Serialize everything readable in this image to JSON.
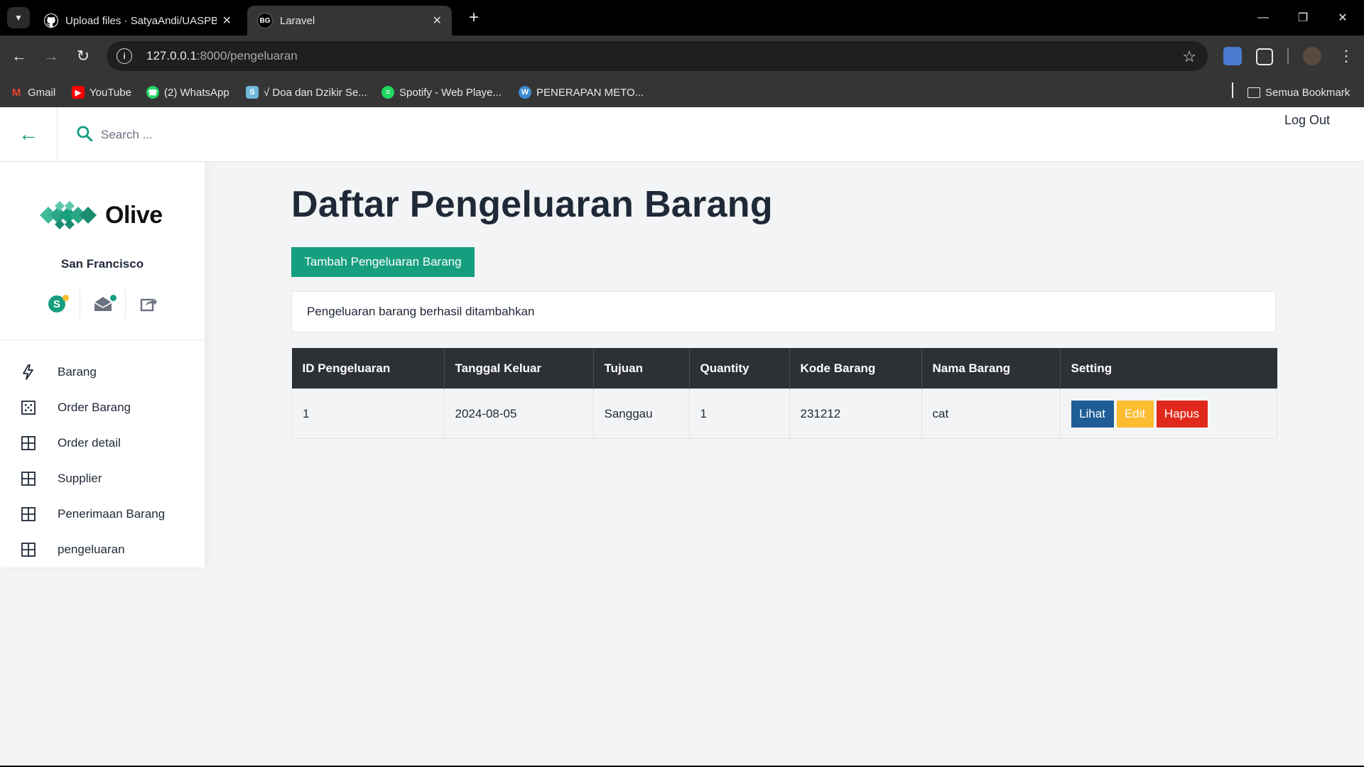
{
  "browser": {
    "tabs": [
      {
        "title": "Upload files · SatyaAndi/UASPB",
        "icon": "github-icon"
      },
      {
        "title": "Laravel",
        "icon": "bg-favicon",
        "favicon_text": "BG"
      }
    ],
    "url_host": "127.0.0.1",
    "url_rest": ":8000/pengeluaran",
    "bookmarks": [
      "Gmail",
      "YouTube",
      "(2) WhatsApp",
      "√ Doa dan Dzikir Se...",
      "Spotify - Web Playe...",
      "PENERAPAN METO..."
    ],
    "all_bookmarks": "Semua Bookmark"
  },
  "header": {
    "search_placeholder": "Search ...",
    "logout": "Log Out"
  },
  "sidebar": {
    "brand": "Olive",
    "location": "San Francisco",
    "items": [
      {
        "label": "Barang",
        "icon": "lightning-icon"
      },
      {
        "label": "Order Barang",
        "icon": "calculator-icon"
      },
      {
        "label": "Order detail",
        "icon": "grid-icon"
      },
      {
        "label": "Supplier",
        "icon": "grid-icon"
      },
      {
        "label": "Penerimaan Barang",
        "icon": "grid-icon"
      },
      {
        "label": "pengeluaran",
        "icon": "grid-icon"
      }
    ]
  },
  "main": {
    "title": "Daftar Pengeluaran Barang",
    "add_button": "Tambah Pengeluaran Barang",
    "alert": "Pengeluaran barang berhasil ditambahkan",
    "columns": [
      "ID Pengeluaran",
      "Tanggal Keluar",
      "Tujuan",
      "Quantity",
      "Kode Barang",
      "Nama Barang",
      "Setting"
    ],
    "rows": [
      {
        "id": "1",
        "tanggal": "2024-08-05",
        "tujuan": "Sanggau",
        "quantity": "1",
        "kode": "231212",
        "nama": "cat"
      }
    ],
    "actions": {
      "view": "Lihat",
      "edit": "Edit",
      "delete": "Hapus"
    }
  },
  "colors": {
    "accent": "#169e7f",
    "view": "#1f5d96",
    "edit": "#fbbd2f",
    "delete": "#e0291c",
    "table_header": "#2d3035"
  }
}
